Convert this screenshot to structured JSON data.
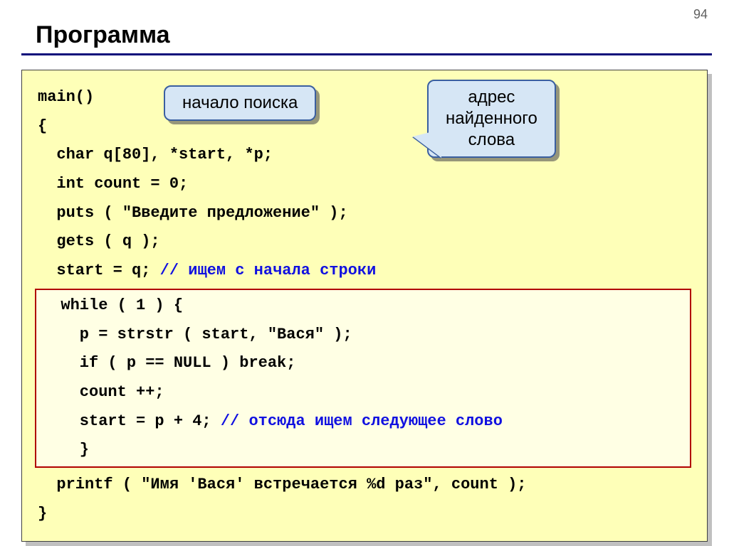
{
  "page_number": "94",
  "title": "Программа",
  "callouts": {
    "c1": "начало поиска",
    "c2_line1": "адрес",
    "c2_line2": "найденного",
    "c2_line3": "слова"
  },
  "code": {
    "l1": "main()",
    "l2": "{",
    "l3": "  char q[80], *start, *p;",
    "l4": "  int count = 0;",
    "l5": "  puts ( \"Введите предложение\" );",
    "l6": "  gets ( q );",
    "l7a": "  start = q; ",
    "l7b": "// ищем с начала строки",
    "l8": "  while ( 1 ) {",
    "l9": "    p = strstr ( start, \"Вася\" );",
    "l10": "    if ( p == NULL ) break;",
    "l11": "    count ++;",
    "l12a": "    start = p + 4; ",
    "l12b": "// отсюда ищем следующее слово",
    "l13": "    }",
    "l14": "  printf ( \"Имя 'Вася' встречается %d раз\", count );",
    "l15": "}"
  }
}
